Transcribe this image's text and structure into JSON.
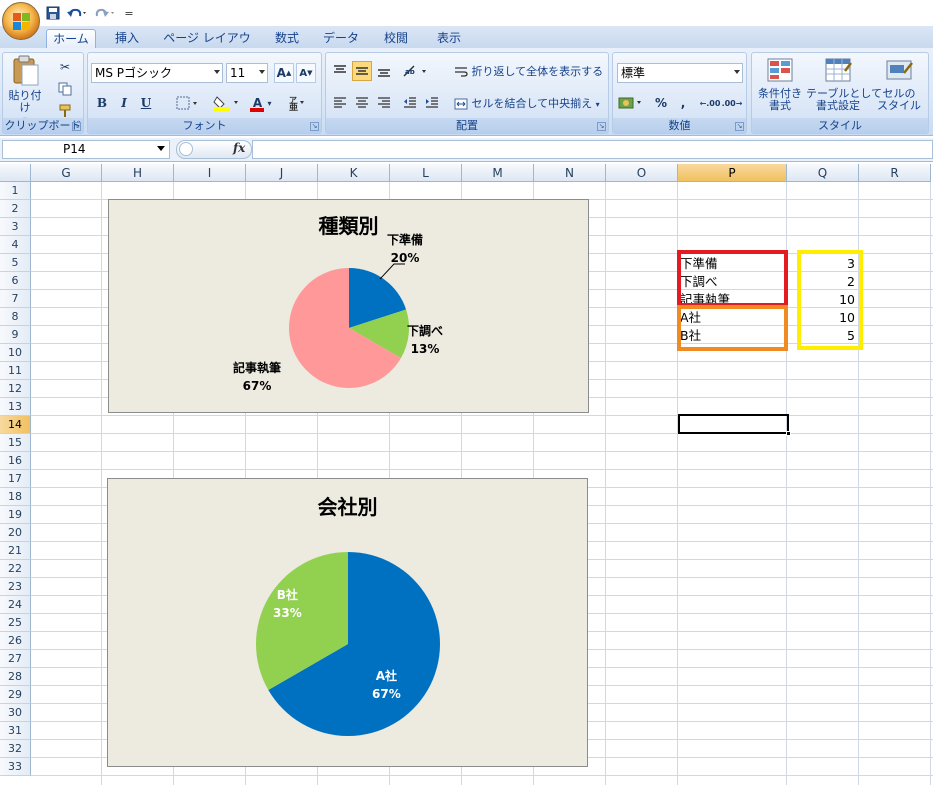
{
  "app": {
    "qat_extra": "="
  },
  "tabs": [
    "ホーム",
    "挿入",
    "ページ レイアウト",
    "数式",
    "データ",
    "校閲",
    "表示"
  ],
  "ribbon": {
    "clipboard": {
      "paste_label": "貼り付け",
      "group_label": "クリップボード"
    },
    "font": {
      "font_name": "MS Pゴシック",
      "font_size": "11",
      "group_label": "フォント",
      "bold": "B",
      "italic": "I",
      "underline": "U",
      "grow": "A",
      "shrink": "A",
      "color_letter": "A"
    },
    "alignment": {
      "wrap_label": "折り返して全体を表示する",
      "merge_label": "セルを結合して中央揃え",
      "group_label": "配置"
    },
    "number": {
      "format": "標準",
      "percent": "%",
      "comma": ",",
      "inc_decimal": ".00",
      "dec_decimal": ".00",
      "group_label": "数値"
    },
    "styles": {
      "cond_format_label": "条件付き\n書式",
      "table_format_label": "テーブルとして\n書式設定",
      "cell_style_label": "セルの\nスタイル",
      "group_label": "スタイル"
    }
  },
  "formula_bar": {
    "name_box": "P14",
    "fx": "fx",
    "content": ""
  },
  "columns": [
    "G",
    "H",
    "I",
    "J",
    "K",
    "L",
    "M",
    "N",
    "O",
    "P",
    "Q",
    "R"
  ],
  "rows": [
    "1",
    "2",
    "3",
    "4",
    "5",
    "6",
    "7",
    "8",
    "9",
    "10",
    "11",
    "12",
    "13",
    "14",
    "15",
    "16",
    "17",
    "18",
    "19",
    "20",
    "21",
    "22",
    "23",
    "24",
    "25",
    "26",
    "27",
    "28",
    "29",
    "30",
    "31",
    "32",
    "33"
  ],
  "selected_column": "P",
  "selected_row": "14",
  "cells": {
    "labels": [
      "下準備",
      "下調べ",
      "記事執筆",
      "A社",
      "B社"
    ],
    "values": [
      "3",
      "2",
      "10",
      "10",
      "5"
    ]
  },
  "colors": {
    "red_box": "#e31c23",
    "orange_box": "#f08a22",
    "yellow_box": "#ffee00",
    "blue": "#0070c0",
    "green": "#92d050",
    "pink": "#ff9999",
    "chart_bg": "#edeae0"
  },
  "chart_data": [
    {
      "type": "pie",
      "title": "種類別",
      "categories": [
        "下準備",
        "下調べ",
        "記事執筆"
      ],
      "values": [
        3,
        2,
        10
      ],
      "percent_labels": [
        "20%",
        "13%",
        "67%"
      ],
      "colors": [
        "#0070c0",
        "#92d050",
        "#ff9999"
      ]
    },
    {
      "type": "pie",
      "title": "会社別",
      "categories": [
        "A社",
        "B社"
      ],
      "values": [
        10,
        5
      ],
      "percent_labels": [
        "67%",
        "33%"
      ],
      "colors": [
        "#0070c0",
        "#92d050"
      ]
    }
  ]
}
